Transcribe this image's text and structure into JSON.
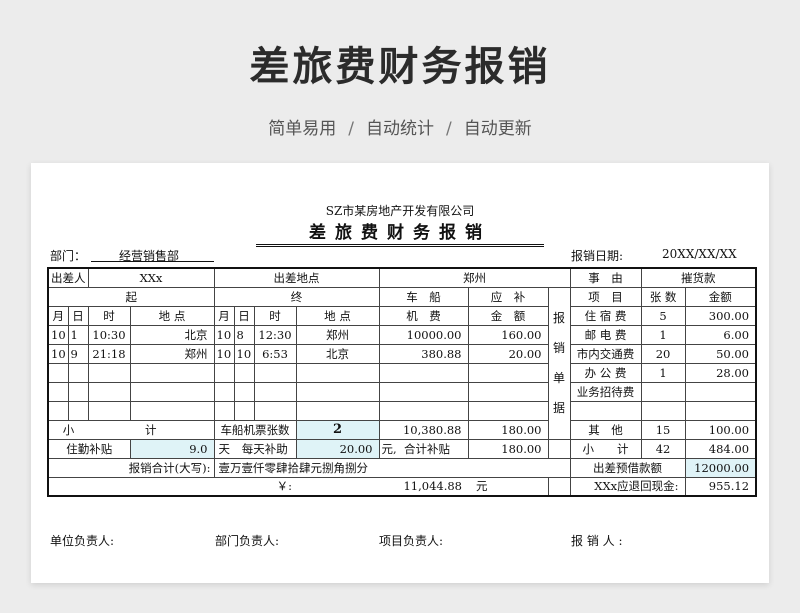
{
  "header": {
    "title": "差旅费财务报销",
    "features": [
      "简单易用",
      "自动统计",
      "自动更新"
    ],
    "separator": "/"
  },
  "form": {
    "company": "SZ市某房地产开发有限公司",
    "title": "差旅费财务报销",
    "dept_label": "部门：",
    "dept_value": "经营销售部",
    "date_label": "报销日期:",
    "date_value": "20XX/XX/XX",
    "traveler_label": "出差人",
    "traveler_value": "XXx",
    "place_label": "出差地点",
    "place_value": "郑州",
    "reason_label": "事　由",
    "reason_value": "摧货款",
    "start_label": "起",
    "end_label": "终",
    "fare_label_1": "车　船",
    "fare_label_2": "机　费",
    "subsidy_label_1": "应　补",
    "subsidy_label_2": "金　额",
    "col_month": "月",
    "col_day": "日",
    "col_time": "时",
    "col_place": "地 点",
    "item_label": "项　目",
    "count_label": "张 数",
    "amount_label": "金额",
    "vertical_label": [
      "报",
      "销",
      "单",
      "据"
    ],
    "trips": [
      {
        "m1": "10",
        "d1": "1",
        "t1": "10:30",
        "p1": "北京",
        "m2": "10",
        "d2": "8",
        "t2": "12:30",
        "p2": "郑州",
        "fare": "10000.00",
        "sub": "160.00"
      },
      {
        "m1": "10",
        "d1": "9",
        "t1": "21:18",
        "p1": "郑州",
        "m2": "10",
        "d2": "10",
        "t2": "6:53",
        "p2": "北京",
        "fare": "380.88",
        "sub": "20.00"
      },
      {
        "m1": "",
        "d1": "",
        "t1": "",
        "p1": "",
        "m2": "",
        "d2": "",
        "t2": "",
        "p2": "",
        "fare": "",
        "sub": ""
      },
      {
        "m1": "",
        "d1": "",
        "t1": "",
        "p1": "",
        "m2": "",
        "d2": "",
        "t2": "",
        "p2": "",
        "fare": "",
        "sub": ""
      },
      {
        "m1": "",
        "d1": "",
        "t1": "",
        "p1": "",
        "m2": "",
        "d2": "",
        "t2": "",
        "p2": "",
        "fare": "",
        "sub": ""
      }
    ],
    "expenses": [
      {
        "name": "住 宿 费",
        "count": "5",
        "amount": "300.00"
      },
      {
        "name": "邮 电 费",
        "count": "1",
        "amount": "6.00"
      },
      {
        "name": "市内交通费",
        "count": "20",
        "amount": "50.00"
      },
      {
        "name": "办 公 费",
        "count": "1",
        "amount": "28.00"
      },
      {
        "name": "业务招待费",
        "count": "",
        "amount": ""
      },
      {
        "name": "",
        "count": "",
        "amount": ""
      }
    ],
    "subtotal_label_1": "小",
    "subtotal_label_2": "计",
    "tickets_label": "车船机票张数",
    "tickets_value": "2",
    "fare_subtotal": "10,380.88",
    "sub_subtotal": "180.00",
    "other_label": "其　他",
    "other_count": "15",
    "other_amount": "100.00",
    "lodging_label": "住勤补贴",
    "lodging_days": "9.0",
    "days_unit": "天",
    "daily_label": "每天补助",
    "daily_value": "20.00",
    "yuan": "元,",
    "total_sub_label": "合计补贴",
    "total_sub_value": "180.00",
    "exp_subtotal_label": "小　　计",
    "exp_subtotal_count": "42",
    "exp_subtotal_amount": "484.00",
    "total_caps_label": "报销合计(大写):",
    "total_caps_value": "壹万壹仟零肆拾肆元捌角捌分",
    "advance_label": "出差预借款额",
    "advance_value": "12000.00",
    "yen_label": "￥:",
    "total_amount": "11,044.88",
    "yuan2": "元",
    "refund_label": "XXx应退回现金:",
    "refund_value": "955.12",
    "sign": {
      "unit": "单位负责人:",
      "dept": "部门负责人:",
      "project": "项目负责人:",
      "reporter": "报 销 人 :"
    }
  }
}
